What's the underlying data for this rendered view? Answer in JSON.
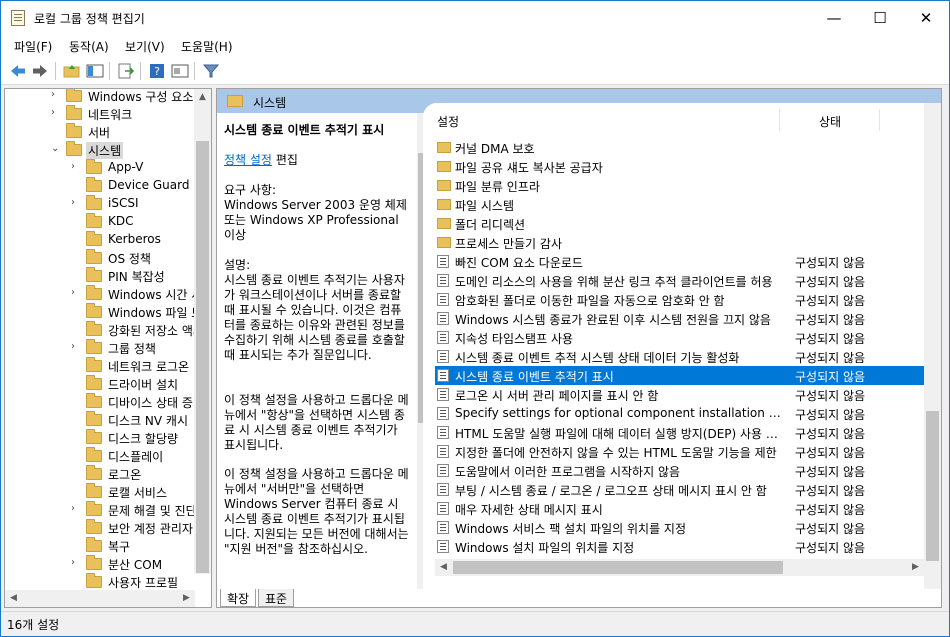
{
  "window": {
    "title": "로컬 그룹 정책 편집기"
  },
  "menu": [
    "파일(F)",
    "동작(A)",
    "보기(V)",
    "도움말(H)"
  ],
  "tree": {
    "items": [
      {
        "label": "Windows 구성 요소",
        "level": 2,
        "expander": "›"
      },
      {
        "label": "네트워크",
        "level": 2,
        "expander": "›"
      },
      {
        "label": "서버",
        "level": 2,
        "expander": ""
      },
      {
        "label": "시스템",
        "level": 2,
        "expander": "⌄",
        "selected": true
      },
      {
        "label": "App-V",
        "level": 3,
        "expander": "›"
      },
      {
        "label": "Device Guard",
        "level": 3,
        "expander": ""
      },
      {
        "label": "iSCSI",
        "level": 3,
        "expander": "›"
      },
      {
        "label": "KDC",
        "level": 3,
        "expander": ""
      },
      {
        "label": "Kerberos",
        "level": 3,
        "expander": ""
      },
      {
        "label": "OS 정책",
        "level": 3,
        "expander": ""
      },
      {
        "label": "PIN 복잡성",
        "level": 3,
        "expander": ""
      },
      {
        "label": "Windows 시간 서비스",
        "level": 3,
        "expander": "›"
      },
      {
        "label": "Windows 파일 보호",
        "level": 3,
        "expander": ""
      },
      {
        "label": "강화된 저장소 액세스",
        "level": 3,
        "expander": ""
      },
      {
        "label": "그룹 정책",
        "level": 3,
        "expander": "›"
      },
      {
        "label": "네트워크 로그온",
        "level": 3,
        "expander": ""
      },
      {
        "label": "드라이버 설치",
        "level": 3,
        "expander": ""
      },
      {
        "label": "디바이스 상태 증명",
        "level": 3,
        "expander": ""
      },
      {
        "label": "디스크 NV 캐시",
        "level": 3,
        "expander": ""
      },
      {
        "label": "디스크 할당량",
        "level": 3,
        "expander": ""
      },
      {
        "label": "디스플레이",
        "level": 3,
        "expander": ""
      },
      {
        "label": "로그온",
        "level": 3,
        "expander": ""
      },
      {
        "label": "로캘 서비스",
        "level": 3,
        "expander": ""
      },
      {
        "label": "문제 해결 및 진단",
        "level": 3,
        "expander": "›"
      },
      {
        "label": "보안 계정 관리자",
        "level": 3,
        "expander": ""
      },
      {
        "label": "복구",
        "level": 3,
        "expander": ""
      },
      {
        "label": "분산 COM",
        "level": 3,
        "expander": "›"
      },
      {
        "label": "사용자 프로필",
        "level": 3,
        "expander": ""
      }
    ]
  },
  "header": {
    "title": "시스템"
  },
  "description": {
    "title": "시스템 종료 이벤트 추적기 표시",
    "policy_link": "정책 설정",
    "edit_label": "편집",
    "requirements_label": "요구 사항:",
    "requirements": "Windows Server 2003 운영 체제 또는 Windows XP Professional 이상",
    "desc_label": "설명:",
    "desc_1": "시스템 종료 이벤트 추적기는 사용자가 워크스테이션이나 서버를 종료할 때 표시될 수 있습니다.  이것은 컴퓨터를 종료하는 이유와 관련된 정보를 수집하기 위해 시스템 종료를 호출할 때 표시되는 추가 질문입니다.",
    "desc_2": "이 정책 설정을 사용하고 드롭다운 메뉴에서 \"항상\"을 선택하면 시스템 종료 시 시스템 종료 이벤트 추적기가 표시됩니다.",
    "desc_3": "이 정책 설정을 사용하고 드롭다운 메뉴에서 \"서버만\"을 선택하면 Windows Server 컴퓨터 종료 시 시스템 종료 이벤트 추적기가 표시됩니다. 지원되는 모든 버전에 대해서는 \"지원 버전\"을 참조하십시오."
  },
  "list": {
    "col_setting": "설정",
    "col_state": "상태",
    "rows": [
      {
        "name": "커널 DMA 보호",
        "state": "",
        "kind": "folder"
      },
      {
        "name": "파일 공유 섀도 복사본 공급자",
        "state": "",
        "kind": "folder"
      },
      {
        "name": "파일 분류 인프라",
        "state": "",
        "kind": "folder"
      },
      {
        "name": "파일 시스템",
        "state": "",
        "kind": "folder"
      },
      {
        "name": "폴더 리디렉션",
        "state": "",
        "kind": "folder"
      },
      {
        "name": "프로세스 만들기 감사",
        "state": "",
        "kind": "folder"
      },
      {
        "name": "빠진 COM 요소 다운로드",
        "state": "구성되지 않음",
        "kind": "setting"
      },
      {
        "name": "도메인 리소스의 사용을 위해 분산 링크 추적 클라이언트를 허용",
        "state": "구성되지 않음",
        "kind": "setting"
      },
      {
        "name": "암호화된 폴더로 이동한 파일을 자동으로 암호화 안 함",
        "state": "구성되지 않음",
        "kind": "setting"
      },
      {
        "name": "Windows 시스템 종료가 완료된 이후 시스템 전원을 끄지 않음",
        "state": "구성되지 않음",
        "kind": "setting"
      },
      {
        "name": "지속성 타임스탬프 사용",
        "state": "구성되지 않음",
        "kind": "setting"
      },
      {
        "name": "시스템 종료 이벤트 추적 시스템 상태 데이터 기능 활성화",
        "state": "구성되지 않음",
        "kind": "setting"
      },
      {
        "name": "시스템 종료 이벤트 추적기 표시",
        "state": "구성되지 않음",
        "kind": "setting",
        "selected": true
      },
      {
        "name": "로그온 시 서버 관리 페이지를 표시 안 함",
        "state": "구성되지 않음",
        "kind": "setting"
      },
      {
        "name": "Specify settings for optional component installation and component repair",
        "state": "구성되지 않음",
        "kind": "setting"
      },
      {
        "name": "HTML 도움말 실행 파일에 대해 데이터 실행 방지(DEP) 사용 안 함",
        "state": "구성되지 않음",
        "kind": "setting"
      },
      {
        "name": "지정한 폴더에 안전하지 않을 수 있는 HTML 도움말 기능을 제한",
        "state": "구성되지 않음",
        "kind": "setting"
      },
      {
        "name": "도움말에서 이러한 프로그램을 시작하지 않음",
        "state": "구성되지 않음",
        "kind": "setting"
      },
      {
        "name": "부팅 / 시스템 종료 / 로그온 / 로그오프 상태 메시지 표시 안 함",
        "state": "구성되지 않음",
        "kind": "setting"
      },
      {
        "name": "매우 자세한 상태 메시지 표시",
        "state": "구성되지 않음",
        "kind": "setting"
      },
      {
        "name": "Windows 서비스 팩 설치 파일의 위치를 지정",
        "state": "구성되지 않음",
        "kind": "setting"
      },
      {
        "name": "Windows 설치 파일의 위치를 지정",
        "state": "구성되지 않음",
        "kind": "setting"
      }
    ]
  },
  "tabs": [
    "확장",
    "표준"
  ],
  "status": {
    "text": "16개 설정"
  },
  "colors": {
    "selection": "#0078d7",
    "header": "#a9c7e8",
    "folder": "#e8c15a"
  }
}
